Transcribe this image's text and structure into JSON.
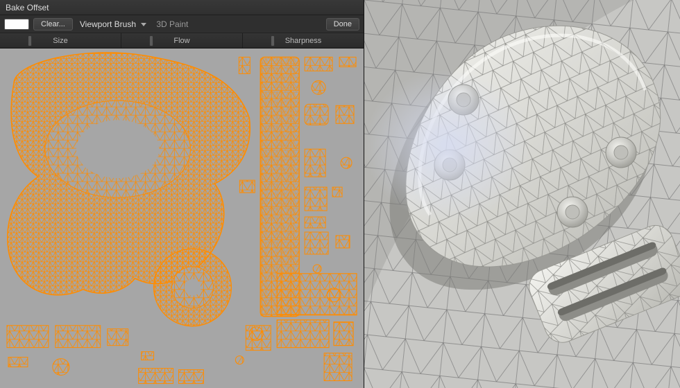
{
  "window": {
    "title": "Bake Offset"
  },
  "toolbar": {
    "color_swatch": "#fefefe",
    "clear_label": "Clear...",
    "brush_dropdown": "Viewport Brush",
    "mode_label": "3D Paint",
    "done_label": "Done"
  },
  "sliders": {
    "size": "Size",
    "flow": "Flow",
    "sharpness": "Sharpness"
  },
  "uv": {
    "wire_color": "#ff8c00",
    "bg_color": "#a6a6a6"
  },
  "viewport": {
    "wire_color": "#6b6b6b",
    "surface_color": "#d6d6d2",
    "shadow_color": "#7d7d7d"
  }
}
